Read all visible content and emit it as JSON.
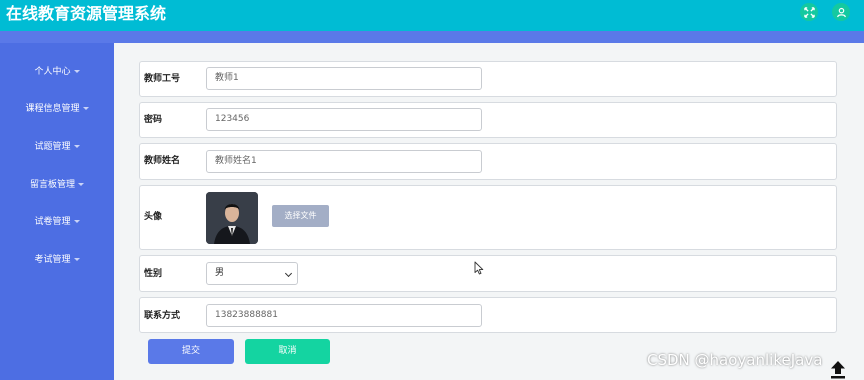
{
  "header": {
    "title": "在线教育资源管理系统",
    "icons": [
      "fullscreen-icon",
      "user-icon"
    ],
    "colors": {
      "topbar": "#00bcd4",
      "subbar": "#5a79e8",
      "icon_bg": "#14c9a0"
    }
  },
  "sidebar": {
    "items": [
      {
        "label": "个人中心"
      },
      {
        "label": "课程信息管理"
      },
      {
        "label": "试题管理"
      },
      {
        "label": "留言板管理"
      },
      {
        "label": "试卷管理"
      },
      {
        "label": "考试管理"
      }
    ],
    "color": "#4d6ee3"
  },
  "form": {
    "teacher_id": {
      "label": "教师工号",
      "value": "教师1"
    },
    "password": {
      "label": "密码",
      "value": "123456"
    },
    "teacher_name": {
      "label": "教师姓名",
      "value": "教师姓名1"
    },
    "avatar": {
      "label": "头像",
      "button_label": "选择文件"
    },
    "gender": {
      "label": "性别",
      "selected": "男"
    },
    "contact": {
      "label": "联系方式",
      "value": "13823888881"
    }
  },
  "actions": {
    "submit_label": "提交",
    "cancel_label": "取消",
    "submit_color": "#5a79e8",
    "cancel_color": "#14d4a1"
  },
  "watermark": "CSDN @haoyanlikeJava"
}
